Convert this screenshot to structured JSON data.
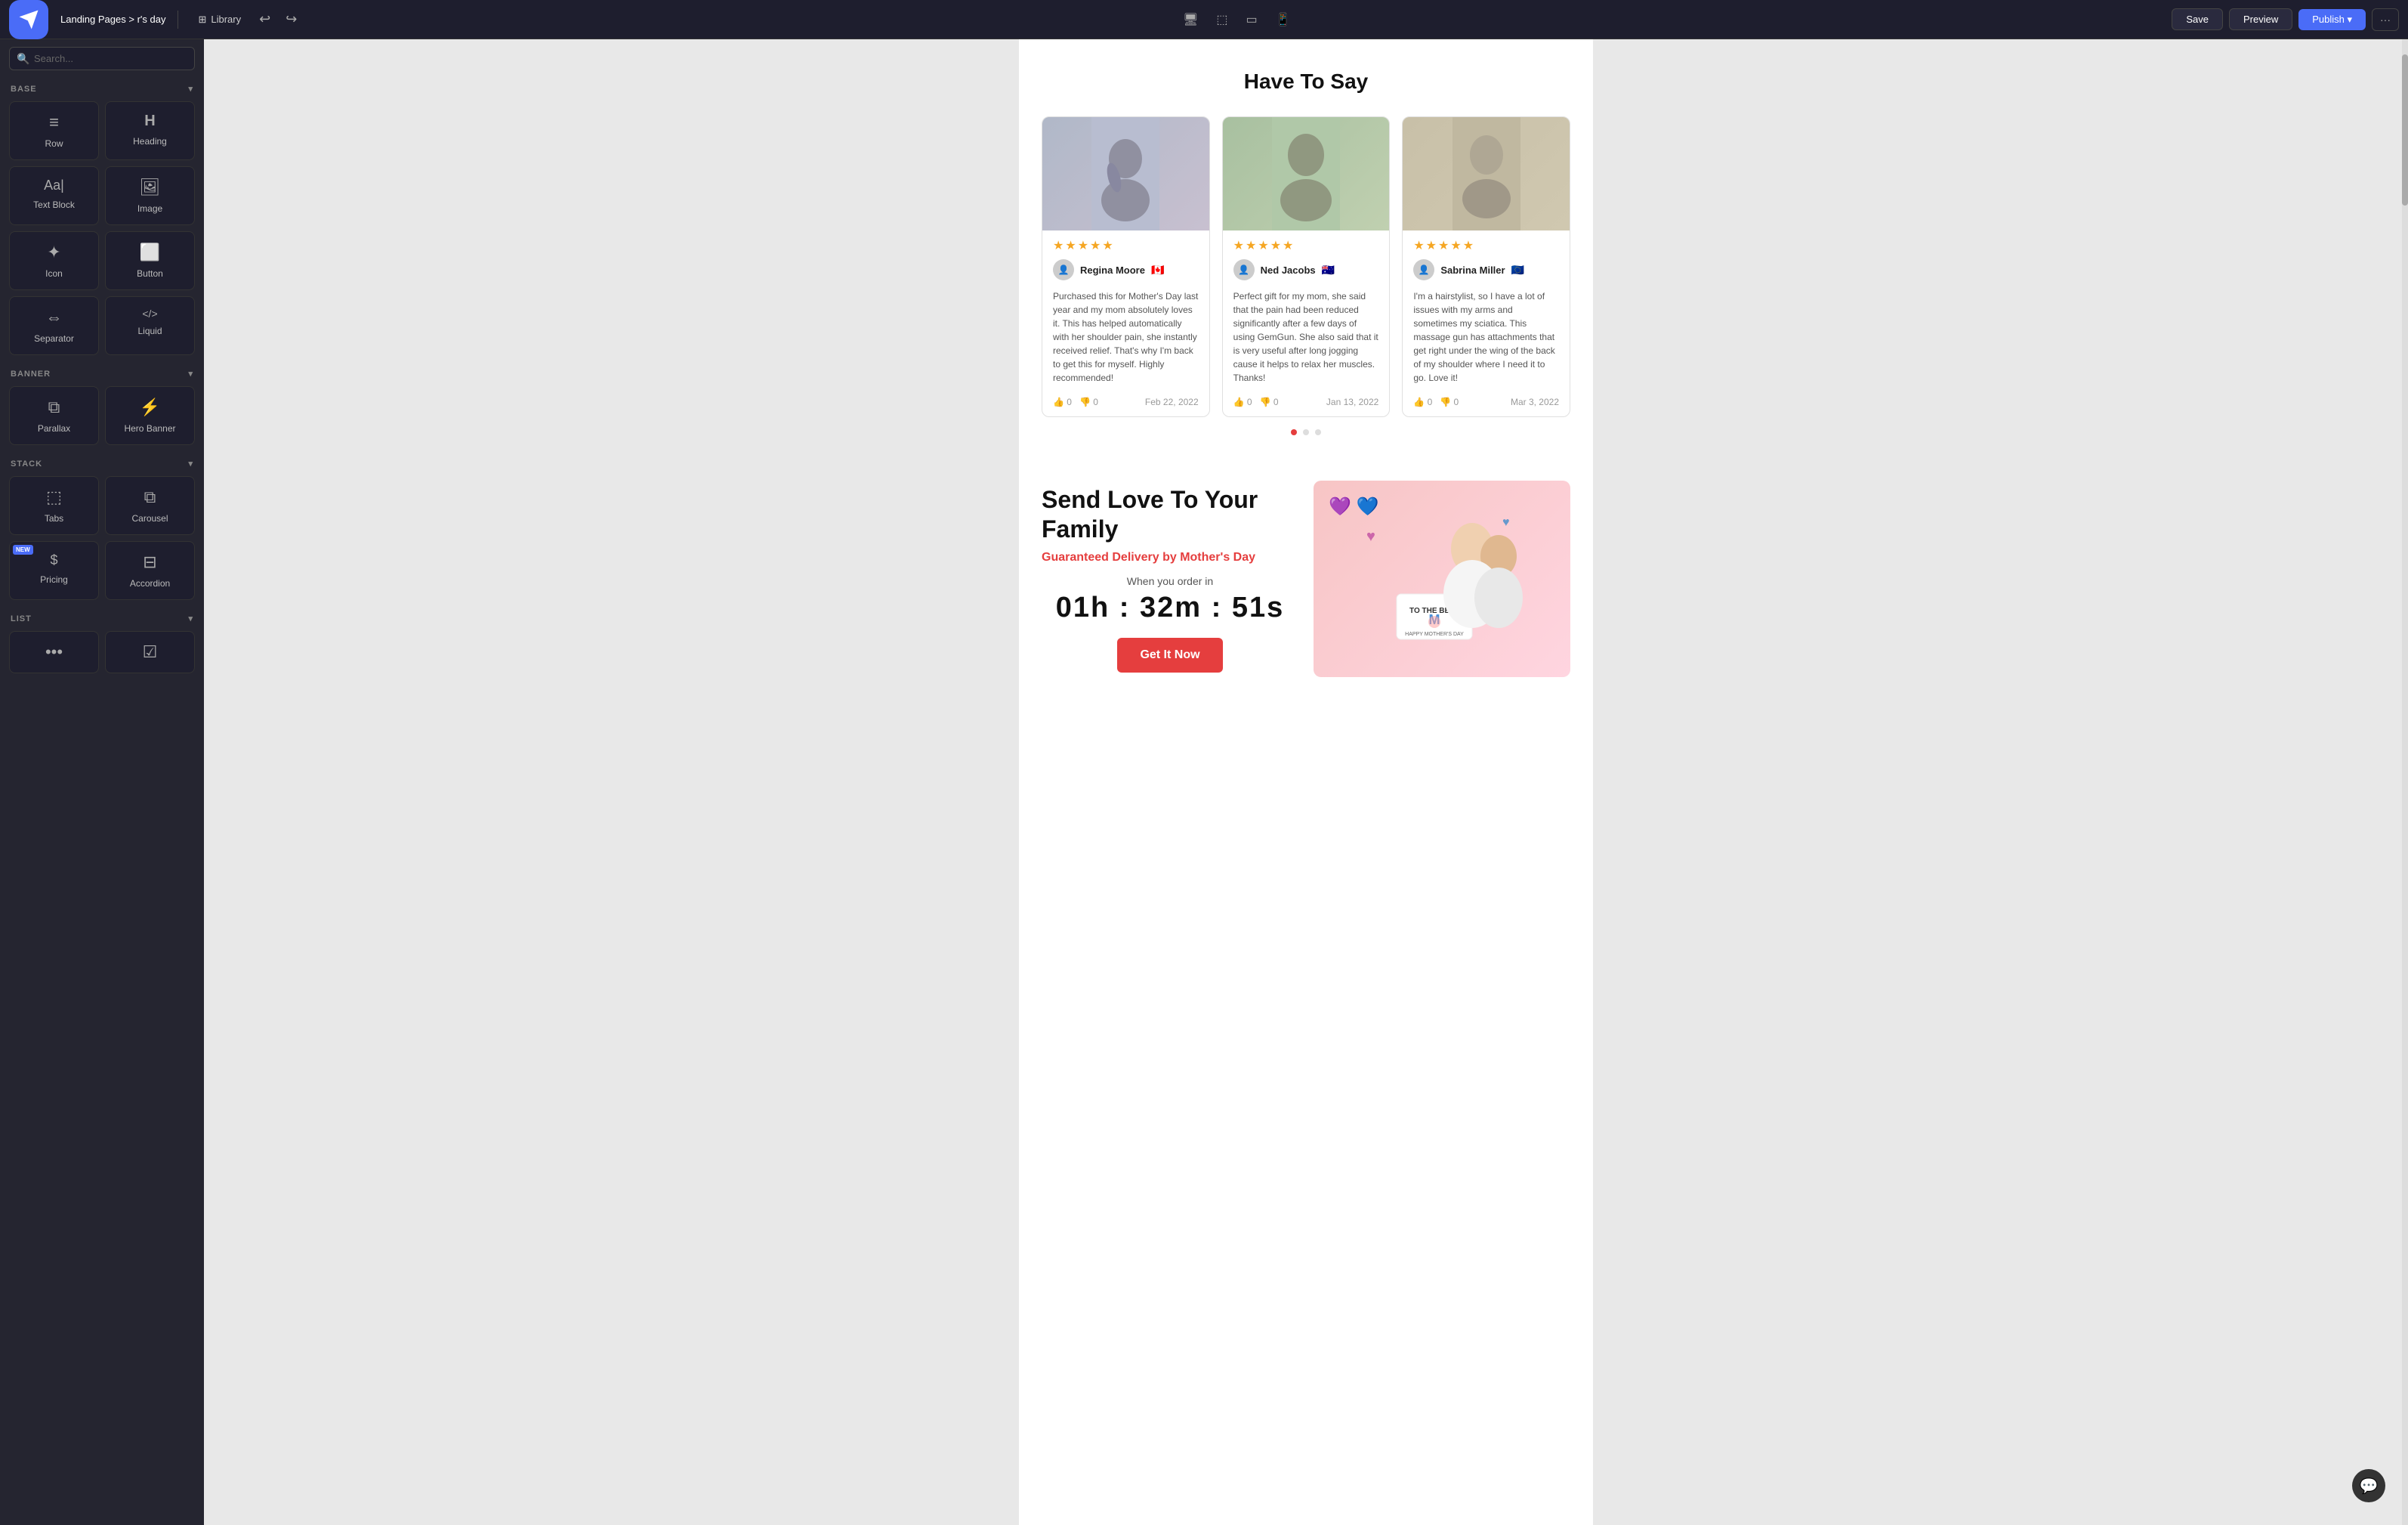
{
  "topbar": {
    "breadcrumb_prefix": "Landing Pages >",
    "breadcrumb_current": "r's day",
    "library_label": "Library",
    "undo_icon": "↩",
    "redo_icon": "↪",
    "device_desktop": "🖥",
    "device_tablet_h": "⬜",
    "device_tablet_v": "📱",
    "device_mobile": "📱",
    "save_label": "Save",
    "preview_label": "Preview",
    "publish_label": "Publish ▾",
    "more_icon": "···"
  },
  "sidebar": {
    "search_placeholder": "Search...",
    "sections": [
      {
        "name": "BASE",
        "items": [
          {
            "id": "row",
            "label": "Row",
            "icon": "≡"
          },
          {
            "id": "heading",
            "label": "Heading",
            "icon": "H"
          },
          {
            "id": "text-block",
            "label": "Text Block",
            "icon": "Aa"
          },
          {
            "id": "image",
            "label": "Image",
            "icon": "🖼"
          },
          {
            "id": "icon",
            "label": "Icon",
            "icon": "✦"
          },
          {
            "id": "button",
            "label": "Button",
            "icon": "⬜"
          },
          {
            "id": "separator",
            "label": "Separator",
            "icon": "⇔"
          },
          {
            "id": "liquid",
            "label": "Liquid",
            "icon": "</>"
          }
        ]
      },
      {
        "name": "BANNER",
        "items": [
          {
            "id": "parallax",
            "label": "Parallax",
            "icon": "⧉"
          },
          {
            "id": "hero-banner",
            "label": "Hero Banner",
            "icon": "⚡"
          }
        ]
      },
      {
        "name": "STACK",
        "items": [
          {
            "id": "tabs",
            "label": "Tabs",
            "icon": "⬚"
          },
          {
            "id": "carousel",
            "label": "Carousel",
            "icon": "⧉"
          },
          {
            "id": "pricing",
            "label": "Pricing",
            "icon": "$",
            "badge": "NEW"
          },
          {
            "id": "accordion",
            "label": "Accordion",
            "icon": "⊟"
          }
        ]
      },
      {
        "name": "LIST",
        "items": [
          {
            "id": "bullet-list",
            "label": "",
            "icon": "•••"
          },
          {
            "id": "checklist",
            "label": "",
            "icon": "☑"
          }
        ]
      }
    ]
  },
  "canvas": {
    "reviews_section": {
      "title": "Have To Say",
      "cards": [
        {
          "reviewer": "Regina Moore",
          "flag": "🇨🇦",
          "stars": 5,
          "text": "Purchased this for Mother's Day last year and my mom absolutely loves it. This has helped automatically with her shoulder pain, she instantly received relief. That's why I'm back to get this for myself. Highly recommended!",
          "likes": 0,
          "dislikes": 0,
          "date": "Feb 22, 2022",
          "img_color": "#c5c5d0"
        },
        {
          "reviewer": "Ned Jacobs",
          "flag": "🇦🇺",
          "stars": 5,
          "text": "Perfect gift for my mom, she said that the pain had been reduced significantly after a few days of using GemGun. She also said that it is very useful after long jogging cause it helps to relax her muscles. Thanks!",
          "likes": 0,
          "dislikes": 0,
          "date": "Jan 13, 2022",
          "img_color": "#b0c5a0"
        },
        {
          "reviewer": "Sabrina Miller",
          "flag": "🇪🇺",
          "stars": 5,
          "text": "I'm a hairstylist, so I have a lot of issues with my arms and sometimes my sciatica. This massage gun has attachments that get right under the wing of the back of my shoulder where I need it to go. Love it!",
          "likes": 0,
          "dislikes": 0,
          "date": "Mar 3, 2022",
          "img_color": "#d0c5b0"
        }
      ],
      "dots": [
        {
          "active": true
        },
        {
          "active": false
        },
        {
          "active": false
        }
      ]
    },
    "promo_section": {
      "title": "Send Love To Your Family",
      "subtitle": "Guaranteed Delivery by Mother's Day",
      "when_label": "When you order in",
      "timer": "01h : 32m : 51s",
      "cta_label": "Get It Now",
      "hearts": "💜💙"
    }
  }
}
